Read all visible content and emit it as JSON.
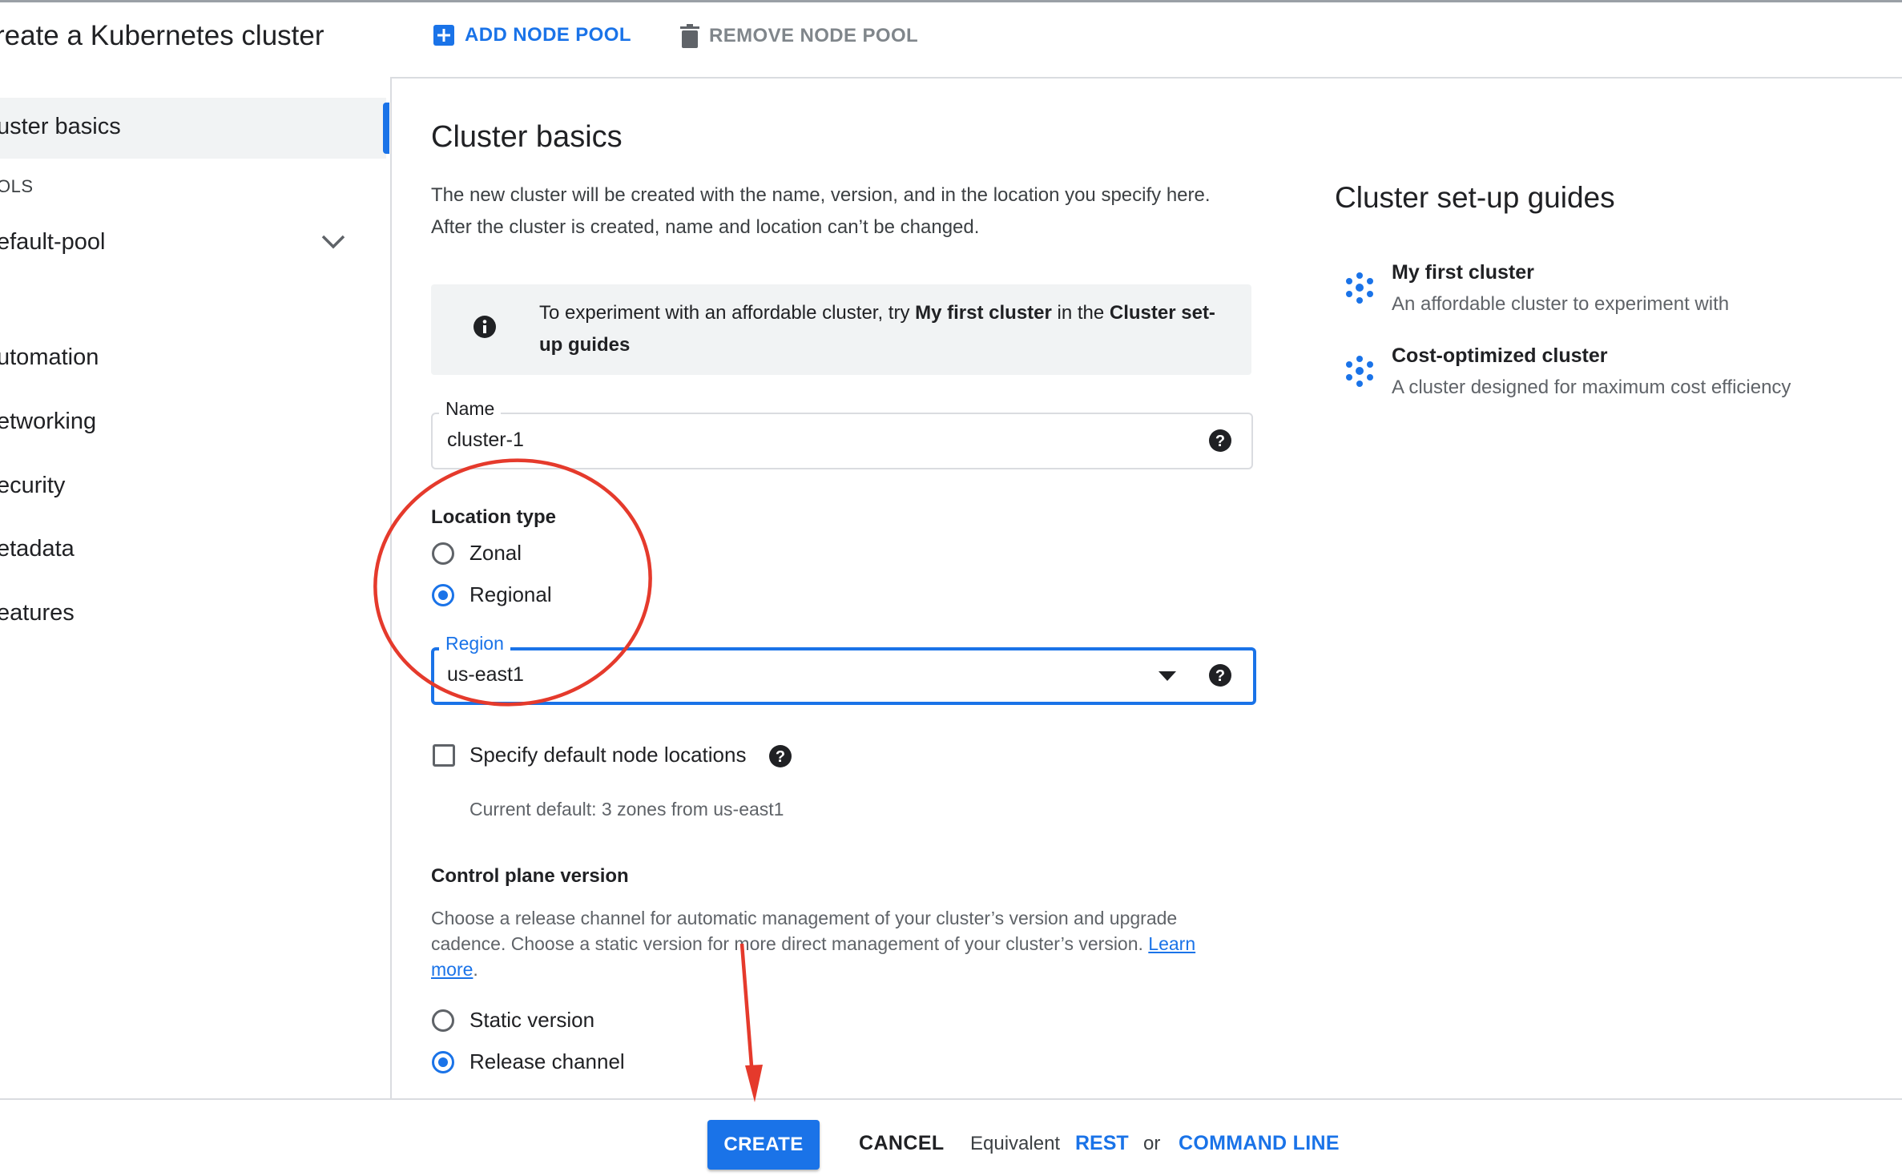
{
  "header": {
    "title": "reate a Kubernetes cluster",
    "add_node_pool": "ADD NODE POOL",
    "remove_node_pool": "REMOVE NODE POOL"
  },
  "sidebar": {
    "items": [
      {
        "label": "uster basics",
        "active": true
      },
      {
        "label": "OLS",
        "kind": "section-label"
      },
      {
        "label": "efault-pool",
        "expandable": true
      },
      {
        "label": "utomation"
      },
      {
        "label": "etworking"
      },
      {
        "label": "ecurity"
      },
      {
        "label": "etadata"
      },
      {
        "label": "eatures"
      }
    ]
  },
  "main": {
    "title": "Cluster basics",
    "description": "The new cluster will be created with the name, version, and in the location you specify here. After the cluster is created, name and location can’t be changed.",
    "info": {
      "pre": "To experiment with an affordable cluster, try ",
      "bold1": "My first cluster",
      "mid": " in the ",
      "bold2": "Cluster set-up guides"
    },
    "name_field": {
      "label": "Name",
      "value": "cluster-1"
    },
    "location_type": {
      "label": "Location type",
      "options": [
        {
          "label": "Zonal",
          "selected": false
        },
        {
          "label": "Regional",
          "selected": true
        }
      ]
    },
    "region_field": {
      "label": "Region",
      "value": "us-east1"
    },
    "default_node_locations": {
      "label": "Specify default node locations",
      "checked": false,
      "helper": "Current default: 3 zones from us-east1"
    },
    "control_plane": {
      "title": "Control plane version",
      "desc_line1": "Choose a release channel for automatic management of your cluster’s version and upgrade",
      "desc_line2": "cadence. Choose a static version for more direct management of your cluster’s version. ",
      "learn_more_1": "Learn",
      "learn_more_2": "more",
      "period": ".",
      "options": [
        {
          "label": "Static version",
          "selected": false
        },
        {
          "label": "Release channel",
          "selected": true
        }
      ]
    }
  },
  "guides": {
    "title": "Cluster set-up guides",
    "items": [
      {
        "title": "My first cluster",
        "subtitle": "An affordable cluster to experiment with"
      },
      {
        "title": "Cost-optimized cluster",
        "subtitle": "A cluster designed for maximum cost efficiency"
      }
    ]
  },
  "footer": {
    "create": "CREATE",
    "cancel": "CANCEL",
    "equivalent": "Equivalent",
    "rest": "REST",
    "or": "or",
    "command_line": "COMMAND LINE"
  },
  "colors": {
    "accent": "#1a73e8",
    "annotation": "#e53a2c"
  },
  "icons": [
    "add-box-icon",
    "trash-icon",
    "chevron-down-icon",
    "info-icon",
    "help-icon",
    "dropdown-arrow-icon",
    "cluster-dots-icon"
  ]
}
